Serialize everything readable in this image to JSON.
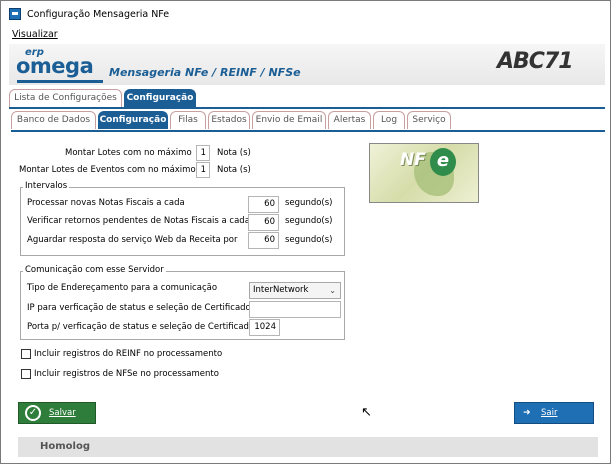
{
  "window": {
    "title": "Configuração Mensageria NFe"
  },
  "menu": {
    "items": [
      {
        "label": "Visualizar"
      }
    ]
  },
  "header": {
    "logo_small": "erp",
    "logo_main": "omega",
    "caption": "Mensageria NFe / REINF / NFSe",
    "brand": "ABC71"
  },
  "outer_tabs": [
    {
      "label": "Lista de Configurações",
      "active": false
    },
    {
      "label": "Configuração",
      "active": true
    }
  ],
  "inner_tabs": [
    {
      "label": "Banco de Dados",
      "active": false
    },
    {
      "label": "Configuração",
      "active": true
    },
    {
      "label": "Filas",
      "active": false
    },
    {
      "label": "Estados",
      "active": false
    },
    {
      "label": "Envio de Email",
      "active": false
    },
    {
      "label": "Alertas",
      "active": false
    },
    {
      "label": "Log",
      "active": false
    },
    {
      "label": "Serviço",
      "active": false
    }
  ],
  "lotes": {
    "row1_label": "Montar Lotes com no máximo",
    "row1_value": "1",
    "row1_unit": "Nota (s)",
    "row2_label": "Montar Lotes de Eventos com no máximo",
    "row2_value": "1",
    "row2_unit": "Nota (s)"
  },
  "intervalos": {
    "title": "Intervalos",
    "rows": [
      {
        "label": "Processar novas Notas Fiscais a cada",
        "value": "60",
        "unit": "segundo(s)"
      },
      {
        "label": "Verificar retornos pendentes de Notas Fiscais a cada",
        "value": "60",
        "unit": "segundo(s)"
      },
      {
        "label": "Aguardar resposta do serviço Web da Receita por",
        "value": "60",
        "unit": "segundo(s)"
      }
    ]
  },
  "comunicacao": {
    "title": "Comunicação com esse Servidor",
    "endereco_label": "Tipo de Endereçamento para a comunicação",
    "endereco_value": "InterNetwork",
    "ip_label": "IP para verficação de status e seleção de Certificado",
    "ip_value": "",
    "porta_label": "Porta p/ verficação de status e seleção de Certificado",
    "porta_value": "1024"
  },
  "checks": {
    "reinf_label": "Incluir registros do REINF no processamento",
    "reinf_checked": false,
    "nfse_label": "Incluir registros de NFSe no processamento",
    "nfse_checked": false
  },
  "buttons": {
    "save_label": "Salvar",
    "exit_label": "Sair"
  },
  "nfe_logo": {
    "text": "NF",
    "e": "e"
  },
  "status": {
    "environment": "Homolog"
  }
}
